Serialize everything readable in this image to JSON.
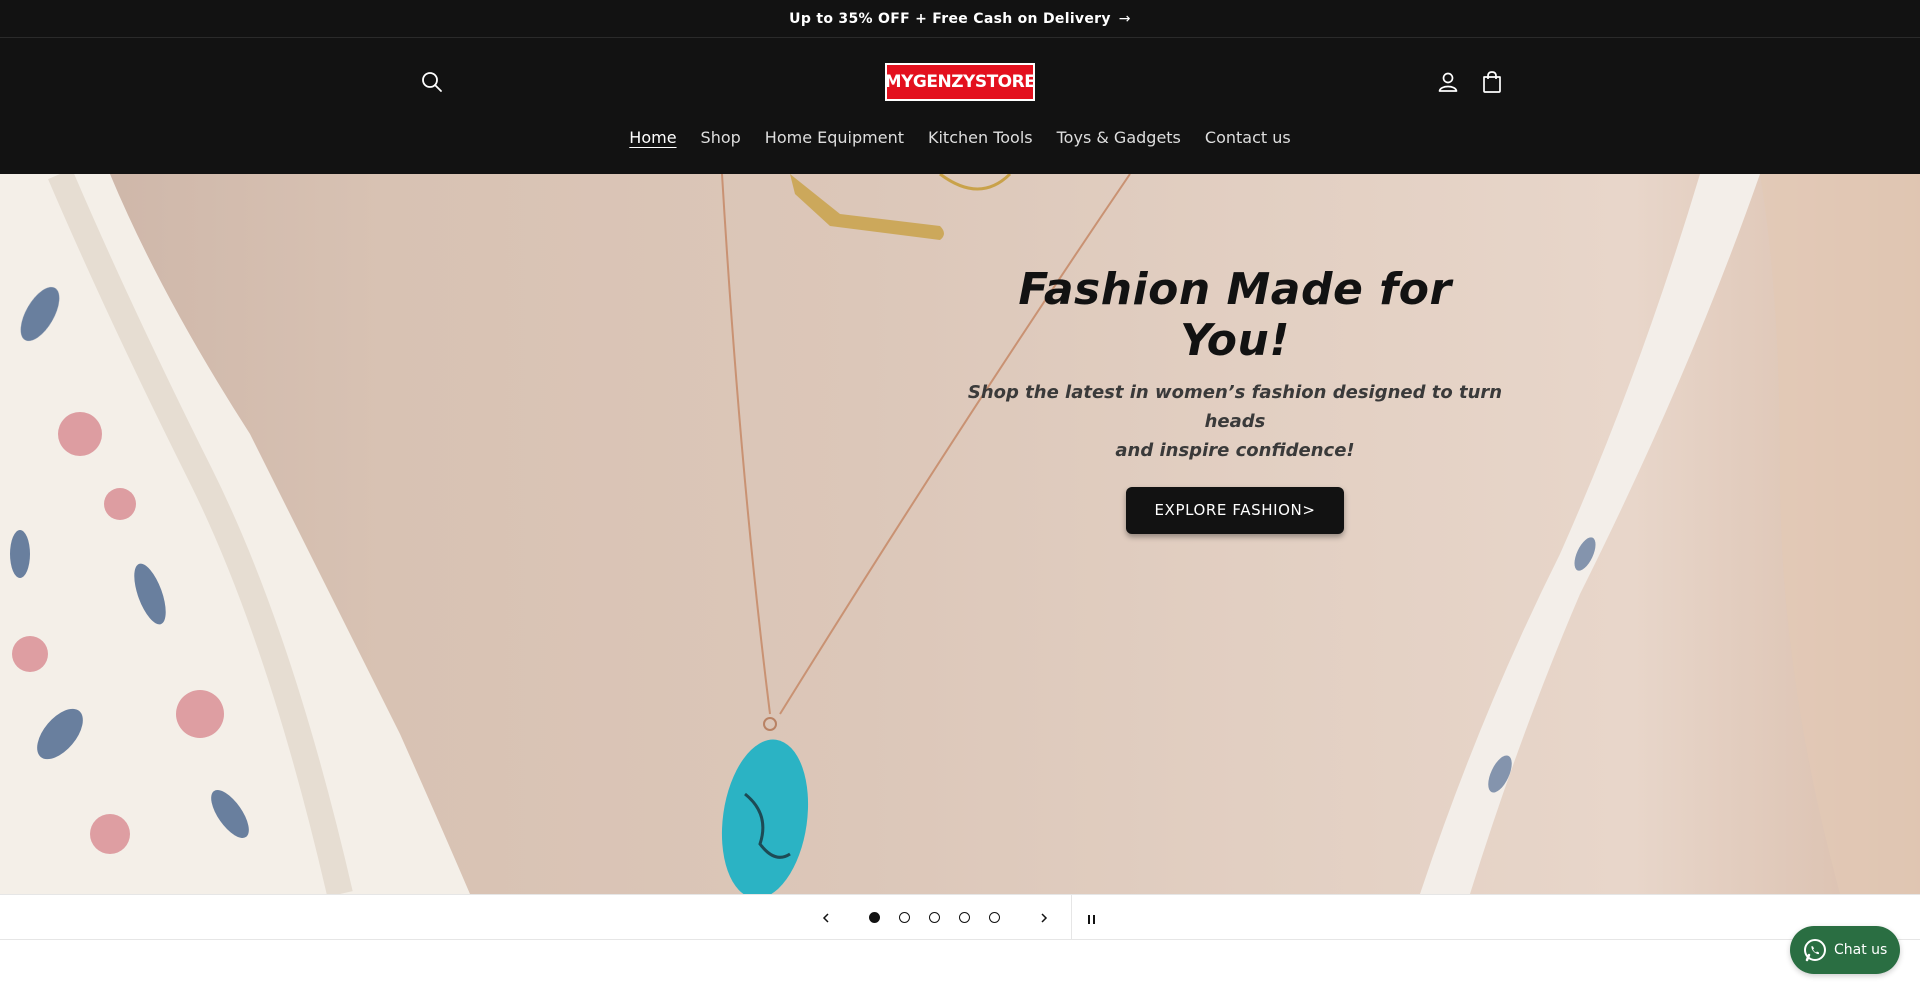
{
  "announcement": {
    "text": "Up to 35% OFF + Free Cash on Delivery",
    "arrow": "→"
  },
  "header": {
    "logo_text": "MYGENZYSTORE",
    "icons": {
      "search": "search-icon",
      "account": "account-icon",
      "cart": "cart-icon"
    }
  },
  "nav": {
    "items": [
      {
        "label": "Home",
        "active": true
      },
      {
        "label": "Shop"
      },
      {
        "label": "Home Equipment"
      },
      {
        "label": "Kitchen Tools"
      },
      {
        "label": "Toys & Gadgets"
      },
      {
        "label": "Contact us"
      }
    ]
  },
  "hero": {
    "title": "Fashion Made for You!",
    "subtitle_line1": "Shop the latest in women’s fashion designed to turn heads",
    "subtitle_line2": "and inspire confidence!",
    "button_label": "EXPLORE FASHION>"
  },
  "slider": {
    "total_slides": 5,
    "current_slide": 1
  },
  "chat": {
    "label": "Chat us"
  },
  "colors": {
    "header_bg": "#121212",
    "logo_bg": "#e3101e",
    "chat_bg": "#2a6e42",
    "turquoise": "#2bb3c4"
  }
}
